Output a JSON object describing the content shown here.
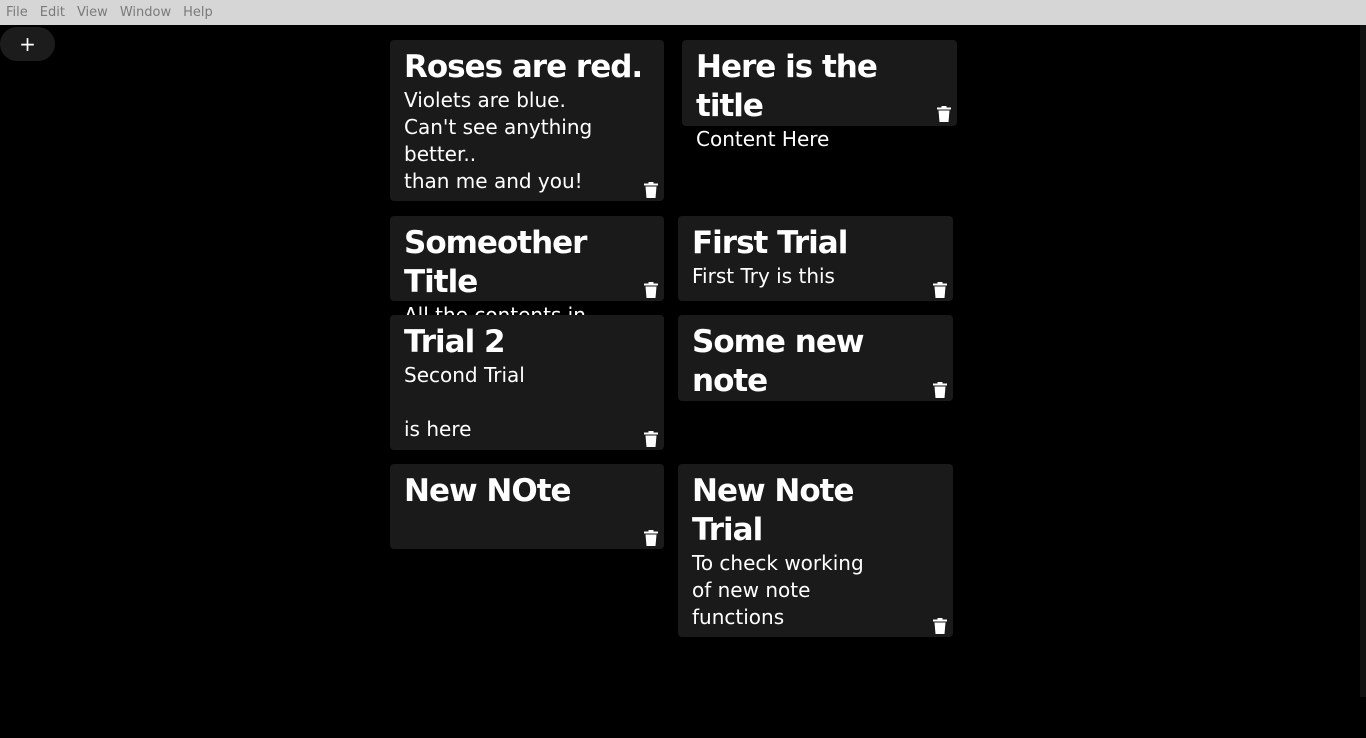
{
  "menubar": {
    "items": [
      "File",
      "Edit",
      "View",
      "Window",
      "Help"
    ]
  },
  "toolbar": {
    "add_label": "+"
  },
  "notes": [
    {
      "title": "Roses are red.",
      "content": "Violets are blue.\nCan't see anything\nbetter..\nthan me and you!"
    },
    {
      "title": "Here is the title",
      "content": "Content Here"
    },
    {
      "title": "Someother Title",
      "content": "All the contents in"
    },
    {
      "title": "First Trial",
      "content": "First Try is this"
    },
    {
      "title": "Trial 2",
      "content": "Second Trial\n\nis here"
    },
    {
      "title": "Some new note",
      "content": ""
    },
    {
      "title": "New NOte",
      "content": ""
    },
    {
      "title": "New Note\nTrial",
      "content": "To check working\nof new note\nfunctions"
    }
  ],
  "icons": {
    "delete": "trash-icon",
    "add": "plus-icon"
  },
  "colors": {
    "background": "#000000",
    "note_background": "#1a1a1a",
    "menubar_background": "#d6d6d6",
    "text": "#ffffff"
  }
}
